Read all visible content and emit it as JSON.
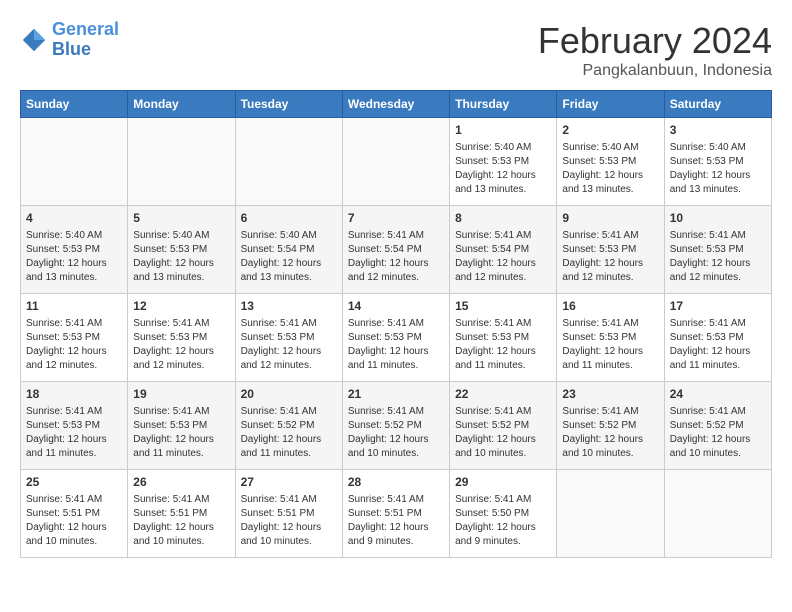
{
  "header": {
    "logo_line1": "General",
    "logo_line2": "Blue",
    "month_year": "February 2024",
    "location": "Pangkalanbuun, Indonesia"
  },
  "weekdays": [
    "Sunday",
    "Monday",
    "Tuesday",
    "Wednesday",
    "Thursday",
    "Friday",
    "Saturday"
  ],
  "weeks": [
    [
      {
        "day": "",
        "info": ""
      },
      {
        "day": "",
        "info": ""
      },
      {
        "day": "",
        "info": ""
      },
      {
        "day": "",
        "info": ""
      },
      {
        "day": "1",
        "info": "Sunrise: 5:40 AM\nSunset: 5:53 PM\nDaylight: 12 hours\nand 13 minutes."
      },
      {
        "day": "2",
        "info": "Sunrise: 5:40 AM\nSunset: 5:53 PM\nDaylight: 12 hours\nand 13 minutes."
      },
      {
        "day": "3",
        "info": "Sunrise: 5:40 AM\nSunset: 5:53 PM\nDaylight: 12 hours\nand 13 minutes."
      }
    ],
    [
      {
        "day": "4",
        "info": "Sunrise: 5:40 AM\nSunset: 5:53 PM\nDaylight: 12 hours\nand 13 minutes."
      },
      {
        "day": "5",
        "info": "Sunrise: 5:40 AM\nSunset: 5:53 PM\nDaylight: 12 hours\nand 13 minutes."
      },
      {
        "day": "6",
        "info": "Sunrise: 5:40 AM\nSunset: 5:54 PM\nDaylight: 12 hours\nand 13 minutes."
      },
      {
        "day": "7",
        "info": "Sunrise: 5:41 AM\nSunset: 5:54 PM\nDaylight: 12 hours\nand 12 minutes."
      },
      {
        "day": "8",
        "info": "Sunrise: 5:41 AM\nSunset: 5:54 PM\nDaylight: 12 hours\nand 12 minutes."
      },
      {
        "day": "9",
        "info": "Sunrise: 5:41 AM\nSunset: 5:53 PM\nDaylight: 12 hours\nand 12 minutes."
      },
      {
        "day": "10",
        "info": "Sunrise: 5:41 AM\nSunset: 5:53 PM\nDaylight: 12 hours\nand 12 minutes."
      }
    ],
    [
      {
        "day": "11",
        "info": "Sunrise: 5:41 AM\nSunset: 5:53 PM\nDaylight: 12 hours\nand 12 minutes."
      },
      {
        "day": "12",
        "info": "Sunrise: 5:41 AM\nSunset: 5:53 PM\nDaylight: 12 hours\nand 12 minutes."
      },
      {
        "day": "13",
        "info": "Sunrise: 5:41 AM\nSunset: 5:53 PM\nDaylight: 12 hours\nand 12 minutes."
      },
      {
        "day": "14",
        "info": "Sunrise: 5:41 AM\nSunset: 5:53 PM\nDaylight: 12 hours\nand 11 minutes."
      },
      {
        "day": "15",
        "info": "Sunrise: 5:41 AM\nSunset: 5:53 PM\nDaylight: 12 hours\nand 11 minutes."
      },
      {
        "day": "16",
        "info": "Sunrise: 5:41 AM\nSunset: 5:53 PM\nDaylight: 12 hours\nand 11 minutes."
      },
      {
        "day": "17",
        "info": "Sunrise: 5:41 AM\nSunset: 5:53 PM\nDaylight: 12 hours\nand 11 minutes."
      }
    ],
    [
      {
        "day": "18",
        "info": "Sunrise: 5:41 AM\nSunset: 5:53 PM\nDaylight: 12 hours\nand 11 minutes."
      },
      {
        "day": "19",
        "info": "Sunrise: 5:41 AM\nSunset: 5:53 PM\nDaylight: 12 hours\nand 11 minutes."
      },
      {
        "day": "20",
        "info": "Sunrise: 5:41 AM\nSunset: 5:52 PM\nDaylight: 12 hours\nand 11 minutes."
      },
      {
        "day": "21",
        "info": "Sunrise: 5:41 AM\nSunset: 5:52 PM\nDaylight: 12 hours\nand 10 minutes."
      },
      {
        "day": "22",
        "info": "Sunrise: 5:41 AM\nSunset: 5:52 PM\nDaylight: 12 hours\nand 10 minutes."
      },
      {
        "day": "23",
        "info": "Sunrise: 5:41 AM\nSunset: 5:52 PM\nDaylight: 12 hours\nand 10 minutes."
      },
      {
        "day": "24",
        "info": "Sunrise: 5:41 AM\nSunset: 5:52 PM\nDaylight: 12 hours\nand 10 minutes."
      }
    ],
    [
      {
        "day": "25",
        "info": "Sunrise: 5:41 AM\nSunset: 5:51 PM\nDaylight: 12 hours\nand 10 minutes."
      },
      {
        "day": "26",
        "info": "Sunrise: 5:41 AM\nSunset: 5:51 PM\nDaylight: 12 hours\nand 10 minutes."
      },
      {
        "day": "27",
        "info": "Sunrise: 5:41 AM\nSunset: 5:51 PM\nDaylight: 12 hours\nand 10 minutes."
      },
      {
        "day": "28",
        "info": "Sunrise: 5:41 AM\nSunset: 5:51 PM\nDaylight: 12 hours\nand 9 minutes."
      },
      {
        "day": "29",
        "info": "Sunrise: 5:41 AM\nSunset: 5:50 PM\nDaylight: 12 hours\nand 9 minutes."
      },
      {
        "day": "",
        "info": ""
      },
      {
        "day": "",
        "info": ""
      }
    ]
  ]
}
